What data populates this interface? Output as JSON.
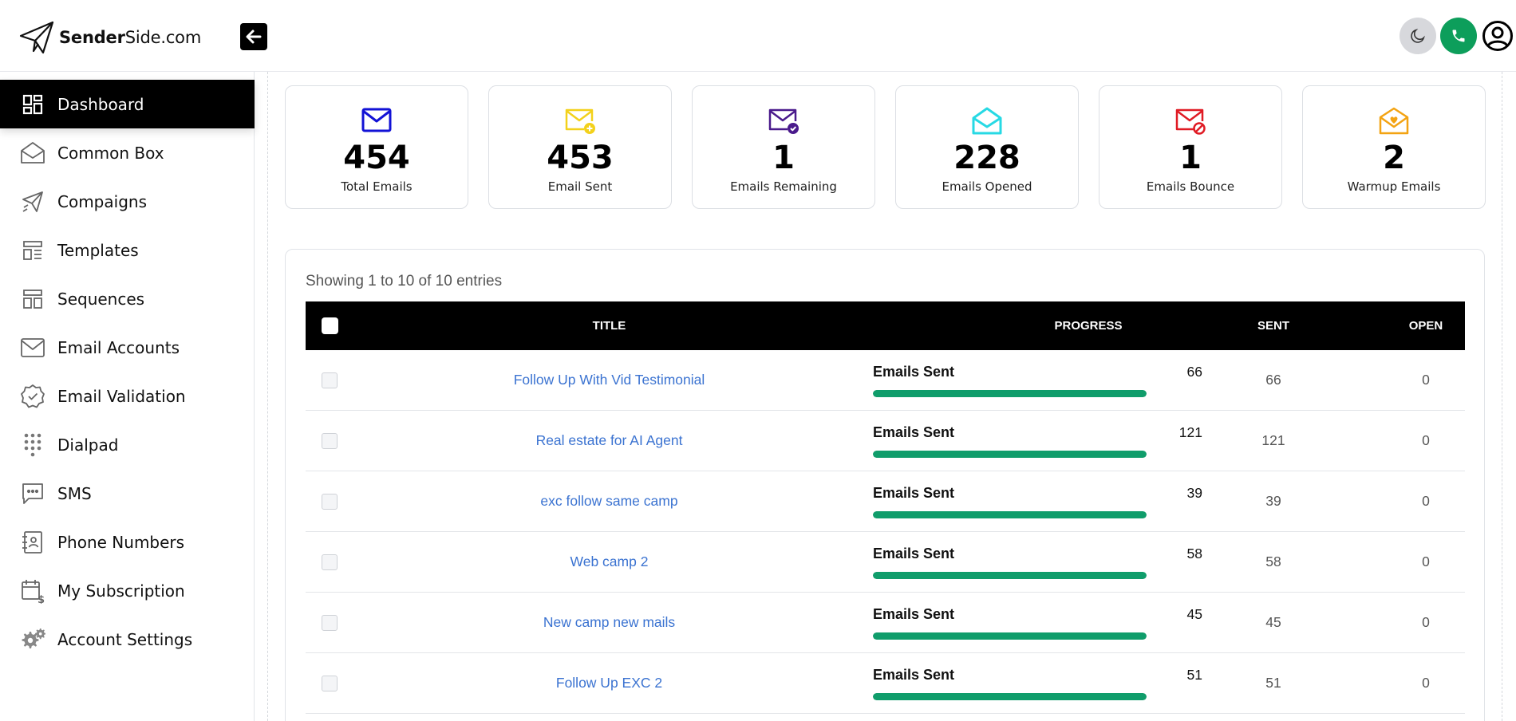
{
  "brand": {
    "name_bold": "Sender",
    "name_rest": "Side.com"
  },
  "sidebar": {
    "items": [
      {
        "label": "Dashboard",
        "icon": "dashboard-icon",
        "active": true
      },
      {
        "label": "Common Box",
        "icon": "inbox-icon"
      },
      {
        "label": "Compaigns",
        "icon": "send-icon"
      },
      {
        "label": "Templates",
        "icon": "template-icon"
      },
      {
        "label": "Sequences",
        "icon": "sequence-icon"
      },
      {
        "label": "Email Accounts",
        "icon": "mail-icon"
      },
      {
        "label": "Email Validation",
        "icon": "badge-check-icon"
      },
      {
        "label": "Dialpad",
        "icon": "dialpad-icon"
      },
      {
        "label": "SMS",
        "icon": "sms-icon"
      },
      {
        "label": "Phone Numbers",
        "icon": "contact-card-icon"
      },
      {
        "label": "My Subscription",
        "icon": "calendar-dollar-icon"
      },
      {
        "label": "Account Settings",
        "icon": "gears-icon"
      }
    ]
  },
  "stats": [
    {
      "value": "454",
      "label": "Total Emails",
      "color": "#1212d6"
    },
    {
      "value": "453",
      "label": "Email Sent",
      "color": "#f3d11b"
    },
    {
      "value": "1",
      "label": "Emails Remaining",
      "color": "#4a1a8c"
    },
    {
      "value": "228",
      "label": "Emails Opened",
      "color": "#27d9e4"
    },
    {
      "value": "1",
      "label": "Emails Bounce",
      "color": "#e01b24"
    },
    {
      "value": "2",
      "label": "Warmup Emails",
      "color": "#f3a312"
    }
  ],
  "table": {
    "entries_text": "Showing 1 to 10 of 10 entries",
    "columns": {
      "title": "TITLE",
      "progress": "PROGRESS",
      "sent": "SENT",
      "open": "OPEN"
    },
    "progress_label": "Emails Sent",
    "rows": [
      {
        "title": "Follow Up With Vid Testimonial",
        "progress": "66",
        "sent": "66",
        "open": "0",
        "fill": 1.0
      },
      {
        "title": "Real estate for AI Agent",
        "progress": "121",
        "sent": "121",
        "open": "0",
        "fill": 1.0
      },
      {
        "title": "exc follow same camp",
        "progress": "39",
        "sent": "39",
        "open": "0",
        "fill": 1.0
      },
      {
        "title": "Web camp 2",
        "progress": "58",
        "sent": "58",
        "open": "0",
        "fill": 1.0
      },
      {
        "title": "New camp new mails",
        "progress": "45",
        "sent": "45",
        "open": "0",
        "fill": 1.0
      },
      {
        "title": "Follow Up EXC 2",
        "progress": "51",
        "sent": "51",
        "open": "0",
        "fill": 1.0
      }
    ]
  },
  "colors": {
    "accent": "#000000",
    "progress": "#109d6b",
    "link": "#3b73d1",
    "call": "#0d9e5b"
  }
}
